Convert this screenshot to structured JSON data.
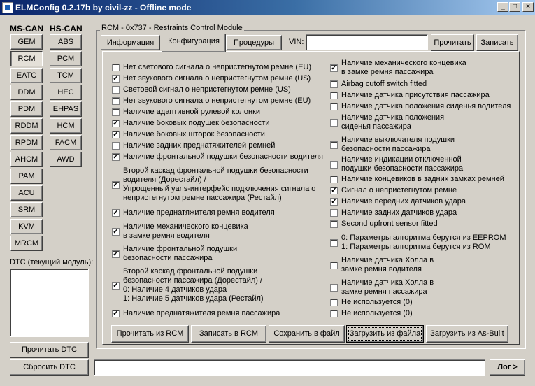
{
  "window": {
    "title": "ELMConfig 0.2.17b by civil-zz - Offline mode"
  },
  "ms_can": {
    "header": "MS-CAN",
    "modules": [
      "GEM",
      "RCM",
      "EATC",
      "DDM",
      "PDM",
      "RDDM",
      "RPDM",
      "AHCM",
      "PAM",
      "ACU",
      "SRM",
      "KVM",
      "MRCM"
    ],
    "active": "RCM"
  },
  "hs_can": {
    "header": "HS-CAN",
    "modules": [
      "ABS",
      "PCM",
      "TCM",
      "HEC",
      "EHPAS",
      "HCM",
      "FACM",
      "AWD"
    ]
  },
  "dtc": {
    "label": "DTC (текущий модуль):",
    "read_label": "Прочитать DTC",
    "reset_label": "Сбросить DTC"
  },
  "module": {
    "title": "RCM - 0x737 - Restraints Control Module"
  },
  "tabs": [
    "Информация",
    "Конфигурация",
    "Процедуры"
  ],
  "active_tab": "Конфигурация",
  "vin": {
    "label": "VIN:",
    "value": "",
    "read_label": "Прочитать",
    "write_label": "Записать"
  },
  "options_left": [
    {
      "text": "Нет светового сигнала о непристегнутом ремне (EU)",
      "checked": false
    },
    {
      "text": "Нет звукового сигнала о непристегнутом ремне (US)",
      "checked": true
    },
    {
      "text": "Световой сигнал о непристегнутом ремне (US)",
      "checked": false
    },
    {
      "text": "Нет звукового сигнала о непристегнутом ремне (EU)",
      "checked": false
    },
    {
      "text": "Наличие адаптивной рулевой колонки",
      "checked": false
    },
    {
      "text": "Наличие боковых подушек безопасности",
      "checked": true
    },
    {
      "text": "Наличие боковых шторок безопасности",
      "checked": true
    },
    {
      "text": "Наличие задних преднатяжителей ремней",
      "checked": false
    },
    {
      "text": "Наличие фронтальной подушки безопасности водителя",
      "checked": true
    },
    {
      "text": "Второй каскад фронтальной подушки безопасности\nводителя (Дорестайл) /\nУпрощенный yaris-интерфейс подключения сигнала о\nнепристегнутом ремне пассажира (Рестайл)",
      "checked": true
    },
    {
      "text": "Наличие преднатяжителя ремня водителя",
      "checked": true
    },
    {
      "text": "Наличие механического концевика\nв замке ремня водителя",
      "checked": true
    },
    {
      "text": "Наличие фронтальной подушки\nбезопасности пассажира",
      "checked": true
    },
    {
      "text": "Второй каскад фронтальной подушки\nбезопасности пассажира (Дорестайл) /\n0: Наличие 4 датчиков удара\n1: Наличие 5 датчиков удара (Рестайл)",
      "checked": true
    },
    {
      "text": "Наличие преднатяжителя ремня пассажира",
      "checked": true
    }
  ],
  "options_right": [
    {
      "text": "Наличие механического концевика\nв замке ремня пассажира",
      "checked": true
    },
    {
      "text": "Airbag cutoff switch fitted",
      "checked": false
    },
    {
      "text": "Наличие датчика присутствия пассажира",
      "checked": false
    },
    {
      "text": "Наличие датчика положения сиденья водителя",
      "checked": false
    },
    {
      "text": "Наличие датчика положения\nсиденья пассажира",
      "checked": false
    },
    {
      "text": "Наличие выключателя подушки\nбезопасности пассажира",
      "checked": false
    },
    {
      "text": "Наличие индикации отключенной\nподушки безопасности пассажира",
      "checked": false
    },
    {
      "text": "Наличие концевиков в задних замках ремней",
      "checked": false
    },
    {
      "text": "Сигнал о непристегнутом ремне",
      "checked": true
    },
    {
      "text": "Наличие передних датчиков удара",
      "checked": true
    },
    {
      "text": "Наличие задних датчиков удара",
      "checked": false
    },
    {
      "text": "Second upfront sensor fitted",
      "checked": false
    },
    {
      "text": "0: Параметры алгоритма берутся из EEPROM\n1: Параметры алгоритма берутся из ROM",
      "checked": false
    },
    {
      "text": "Наличие датчика Холла в\nзамке ремня водителя",
      "checked": false
    },
    {
      "text": "Наличие датчика Холла в\nзамке ремня пассажира",
      "checked": false
    },
    {
      "text": "Не используется (0)",
      "checked": false
    },
    {
      "text": "Не используется (0)",
      "checked": false
    }
  ],
  "actions": [
    "Прочитать из RCM",
    "Записать в RCM",
    "Сохранить в файл",
    "Загрузить из файла",
    "Загрузить из As-Built"
  ],
  "log": {
    "value": "",
    "button_label": "Лог >"
  },
  "window_buttons": {
    "minimize": "_",
    "maximize": "□",
    "close": "×"
  }
}
